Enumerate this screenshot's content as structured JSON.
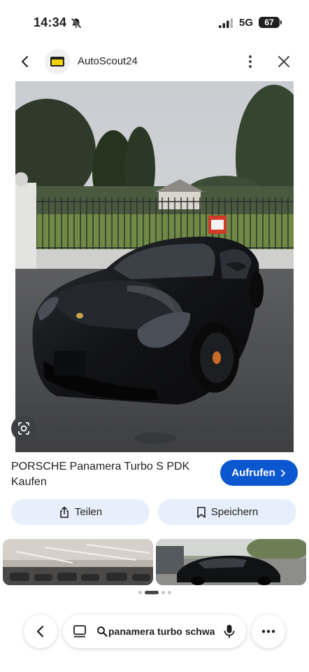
{
  "status_bar": {
    "time": "14:34",
    "network": "5G",
    "battery": "67"
  },
  "header": {
    "site_name": "AutoScout24",
    "icons": [
      "back-arrow-icon",
      "autoscout24-logo",
      "more-vert-icon",
      "close-icon"
    ]
  },
  "result": {
    "title": "PORSCHE Panamera Turbo S PDK Kaufen",
    "visit_label": "Aufrufen",
    "share_label": "Teilen",
    "save_label": "Speichern"
  },
  "related": {
    "count": 2
  },
  "pagination": {
    "dots": 4,
    "active_index": 1
  },
  "search_bar": {
    "query": "panamera turbo schwarz"
  },
  "colors": {
    "accent": "#0b57d0",
    "button_bg": "#e8effc",
    "logo_yellow": "#f5d10a"
  }
}
